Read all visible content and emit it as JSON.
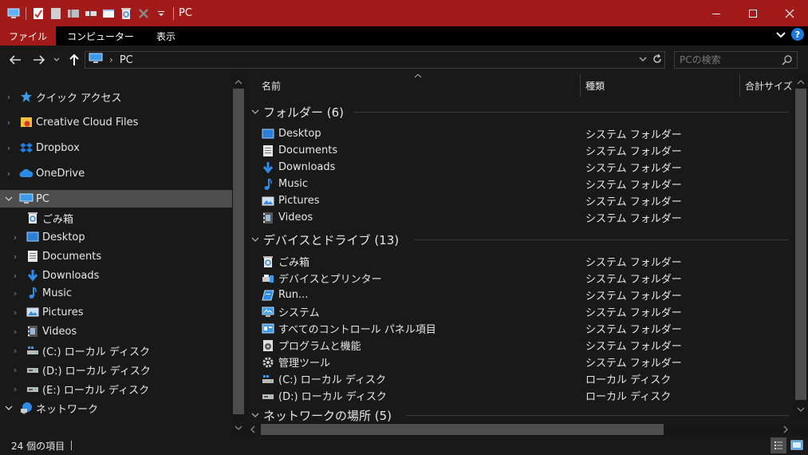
{
  "window": {
    "title": "PC",
    "accent_color": "#a31a1a"
  },
  "quick_access_toolbar": {
    "icons": [
      "computer-icon",
      "properties-icon",
      "new-folder-icon",
      "undo-icon",
      "rename-icon",
      "window-icon",
      "recycle-icon",
      "delete-icon",
      "customize-dropdown-icon"
    ]
  },
  "ribbon": {
    "tabs": [
      {
        "label": "ファイル",
        "active": true
      },
      {
        "label": "コンピューター",
        "active": false
      },
      {
        "label": "表示",
        "active": false
      }
    ]
  },
  "address": {
    "path": "PC",
    "search_placeholder": "PCの検索"
  },
  "nav": {
    "items": [
      {
        "label": "クイック アクセス",
        "icon": "star-icon",
        "expandable": true,
        "indent": 0
      },
      {
        "label": "Creative Cloud Files",
        "icon": "creative-cloud-icon",
        "expandable": true,
        "indent": 0
      },
      {
        "label": "Dropbox",
        "icon": "dropbox-icon",
        "expandable": true,
        "indent": 0
      },
      {
        "label": "OneDrive",
        "icon": "onedrive-icon",
        "expandable": true,
        "indent": 0
      },
      {
        "label": "PC",
        "icon": "pc-icon",
        "expandable": true,
        "expanded": true,
        "indent": 0,
        "selected": true
      },
      {
        "label": "ごみ箱",
        "icon": "recycle-bin-icon",
        "expandable": false,
        "indent": 1
      },
      {
        "label": "Desktop",
        "icon": "desktop-icon",
        "expandable": true,
        "indent": 1
      },
      {
        "label": "Documents",
        "icon": "documents-icon",
        "expandable": true,
        "indent": 1
      },
      {
        "label": "Downloads",
        "icon": "downloads-icon",
        "expandable": true,
        "indent": 1
      },
      {
        "label": "Music",
        "icon": "music-icon",
        "expandable": true,
        "indent": 1
      },
      {
        "label": "Pictures",
        "icon": "pictures-icon",
        "expandable": true,
        "indent": 1
      },
      {
        "label": "Videos",
        "icon": "videos-icon",
        "expandable": true,
        "indent": 1
      },
      {
        "label": "(C:) ローカル ディスク",
        "icon": "windows-drive-icon",
        "expandable": true,
        "indent": 1
      },
      {
        "label": "(D:) ローカル ディスク",
        "icon": "drive-icon",
        "expandable": true,
        "indent": 1
      },
      {
        "label": "(E:) ローカル ディスク",
        "icon": "drive-icon",
        "expandable": true,
        "indent": 1
      },
      {
        "label": "ネットワーク",
        "icon": "network-icon",
        "expandable": true,
        "expanded": true,
        "indent": 0
      }
    ]
  },
  "columns": [
    {
      "label": "名前"
    },
    {
      "label": "種類"
    },
    {
      "label": "合計サイズ"
    }
  ],
  "groups": [
    {
      "label": "フォルダー (6)",
      "rows": [
        {
          "name": "Desktop",
          "type": "システム フォルダー",
          "icon": "desktop-icon"
        },
        {
          "name": "Documents",
          "type": "システム フォルダー",
          "icon": "documents-icon"
        },
        {
          "name": "Downloads",
          "type": "システム フォルダー",
          "icon": "downloads-icon"
        },
        {
          "name": "Music",
          "type": "システム フォルダー",
          "icon": "music-icon"
        },
        {
          "name": "Pictures",
          "type": "システム フォルダー",
          "icon": "pictures-icon"
        },
        {
          "name": "Videos",
          "type": "システム フォルダー",
          "icon": "videos-icon"
        }
      ]
    },
    {
      "label": "デバイスとドライブ (13)",
      "rows": [
        {
          "name": "ごみ箱",
          "type": "システム フォルダー",
          "icon": "recycle-bin-icon"
        },
        {
          "name": "デバイスとプリンター",
          "type": "システム フォルダー",
          "icon": "devices-printers-icon"
        },
        {
          "name": "Run...",
          "type": "システム フォルダー",
          "icon": "run-icon"
        },
        {
          "name": "システム",
          "type": "システム フォルダー",
          "icon": "system-icon"
        },
        {
          "name": "すべてのコントロール パネル項目",
          "type": "システム フォルダー",
          "icon": "control-panel-icon"
        },
        {
          "name": "プログラムと機能",
          "type": "システム フォルダー",
          "icon": "programs-icon"
        },
        {
          "name": "管理ツール",
          "type": "システム フォルダー",
          "icon": "admin-tools-icon"
        },
        {
          "name": "(C:) ローカル ディスク",
          "type": "ローカル ディスク",
          "icon": "windows-drive-icon"
        },
        {
          "name": "(D:) ローカル ディスク",
          "type": "ローカル ディスク",
          "icon": "drive-icon"
        }
      ]
    },
    {
      "label": "ネットワークの場所 (5)",
      "rows": []
    }
  ],
  "status": {
    "item_count": "24 個の項目"
  }
}
